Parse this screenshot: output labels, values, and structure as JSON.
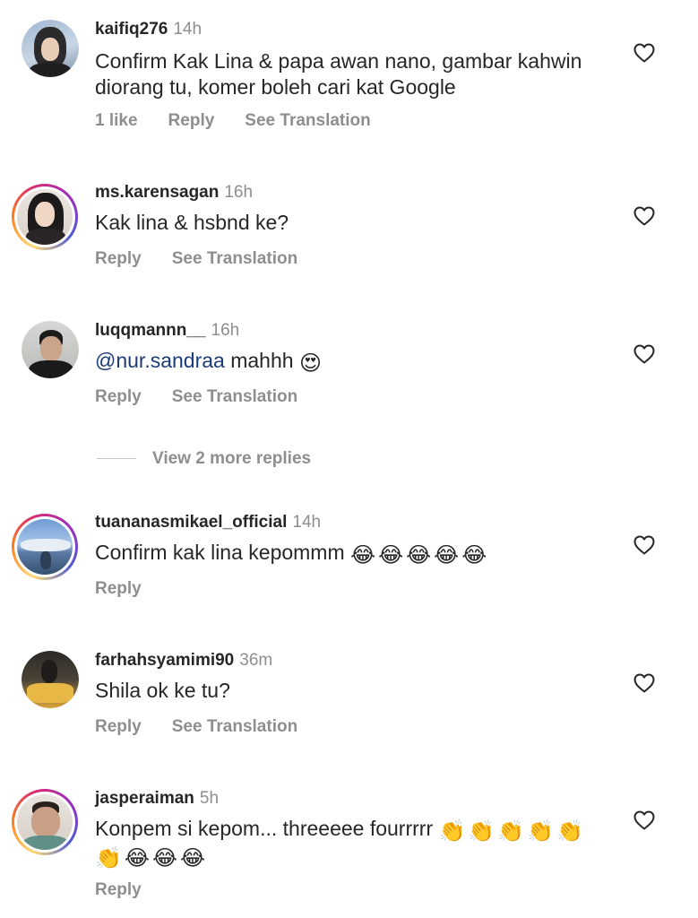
{
  "comments": [
    {
      "username": "kaifiq276",
      "time": "14h",
      "text": "Confirm Kak Lina & papa awan nano, gambar kahwin diorang tu, komer boleh cari kat Google",
      "likes": "1 like",
      "reply": "Reply",
      "see_translation": "See Translation"
    },
    {
      "username": "ms.karensagan",
      "time": "16h",
      "text": "Kak lina & hsbnd ke?",
      "reply": "Reply",
      "see_translation": "See Translation"
    },
    {
      "username": "luqqmannn__",
      "time": "16h",
      "mention": "@nur.sandraa",
      "text": " mahhh",
      "reply": "Reply",
      "see_translation": "See Translation"
    },
    {
      "username": "tuananasmikael_official",
      "time": "14h",
      "text": "Confirm kak lina kepommm",
      "reply": "Reply"
    },
    {
      "username": "farhahsyamimi90",
      "time": "36m",
      "text": "Shila ok ke tu?",
      "reply": "Reply",
      "see_translation": "See Translation"
    },
    {
      "username": "jasperaiman",
      "time": "5h",
      "text": "Konpem si kepom... threeeee fourrrrr",
      "reply": "Reply"
    }
  ],
  "view_replies": "View 2 more replies",
  "emoji": {
    "heart_eyes": "😍",
    "tears_of_joy": "😂",
    "clap": "👏"
  },
  "colors": {
    "username": "#262626",
    "meta": "#8e8e8e",
    "mention": "#1b3b7a",
    "story_ring": "#d62976"
  }
}
